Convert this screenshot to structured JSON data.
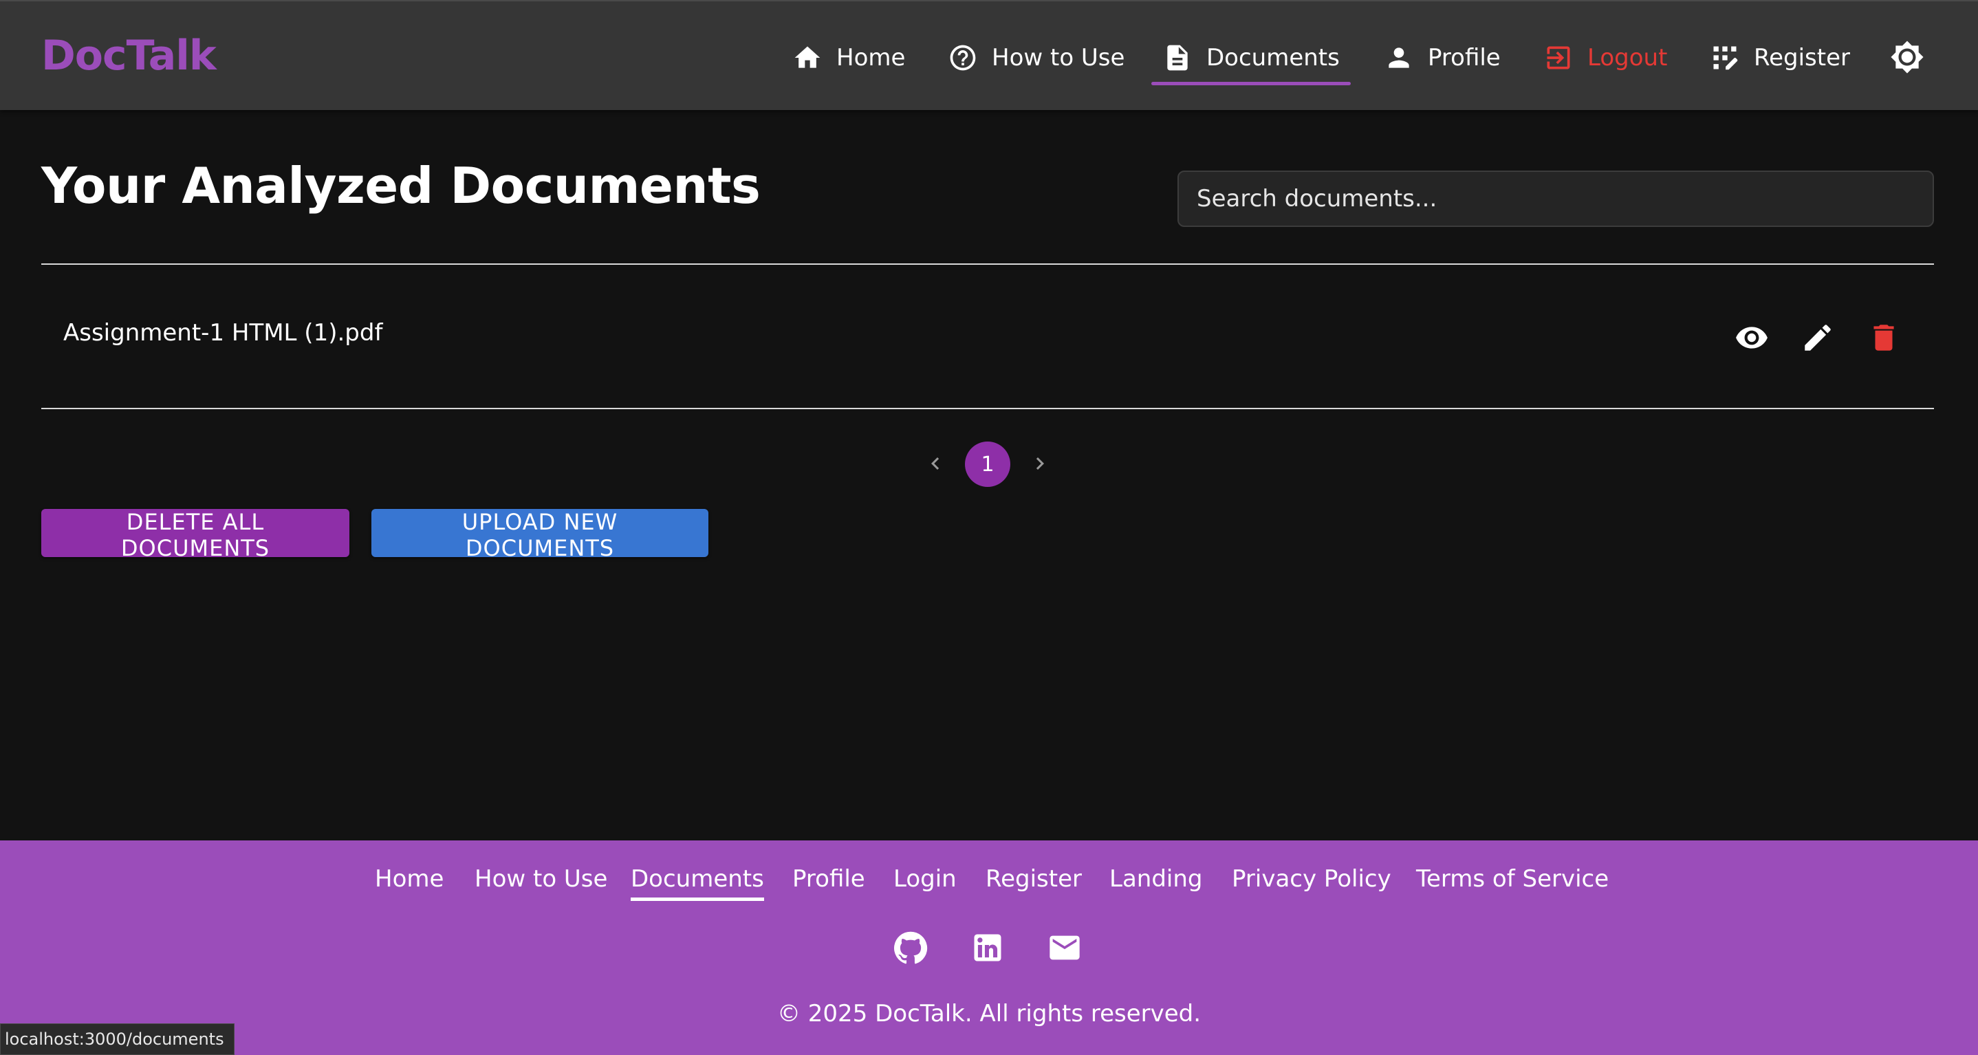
{
  "header": {
    "logo": "DocTalk",
    "nav": [
      {
        "label": "Home",
        "icon": "home-icon"
      },
      {
        "label": "How to Use",
        "icon": "help-circle-icon"
      },
      {
        "label": "Documents",
        "icon": "document-icon",
        "active": true
      },
      {
        "label": "Profile",
        "icon": "person-icon"
      },
      {
        "label": "Logout",
        "icon": "logout-icon",
        "color": "#e53935"
      },
      {
        "label": "Register",
        "icon": "register-icon"
      }
    ],
    "theme_toggle_icon": "brightness-icon"
  },
  "main": {
    "title": "Your Analyzed Documents",
    "search_placeholder": "Search documents...",
    "documents": [
      {
        "name": "Assignment-1 HTML (1).pdf",
        "actions": [
          "view-icon",
          "edit-icon",
          "delete-icon"
        ]
      }
    ],
    "pagination": {
      "current_page": "1"
    },
    "buttons": {
      "delete_all": "DELETE ALL DOCUMENTS",
      "upload": "UPLOAD NEW DOCUMENTS"
    }
  },
  "footer": {
    "links": [
      "Home",
      "How to Use",
      "Documents",
      "Profile",
      "Login",
      "Register",
      "Landing",
      "Privacy Policy",
      "Terms of Service"
    ],
    "active_link": "Documents",
    "social_icons": [
      "github-icon",
      "linkedin-icon",
      "email-icon"
    ],
    "copyright": "© 2025 DocTalk. All rights reserved."
  },
  "status_bar": {
    "url": "localhost:3000/documents"
  },
  "colors": {
    "accent": "#9b4dba",
    "primary_button": "#8e2fa8",
    "upload_button": "#3876d2",
    "danger": "#e53935",
    "background": "#121212",
    "header": "#363636"
  }
}
